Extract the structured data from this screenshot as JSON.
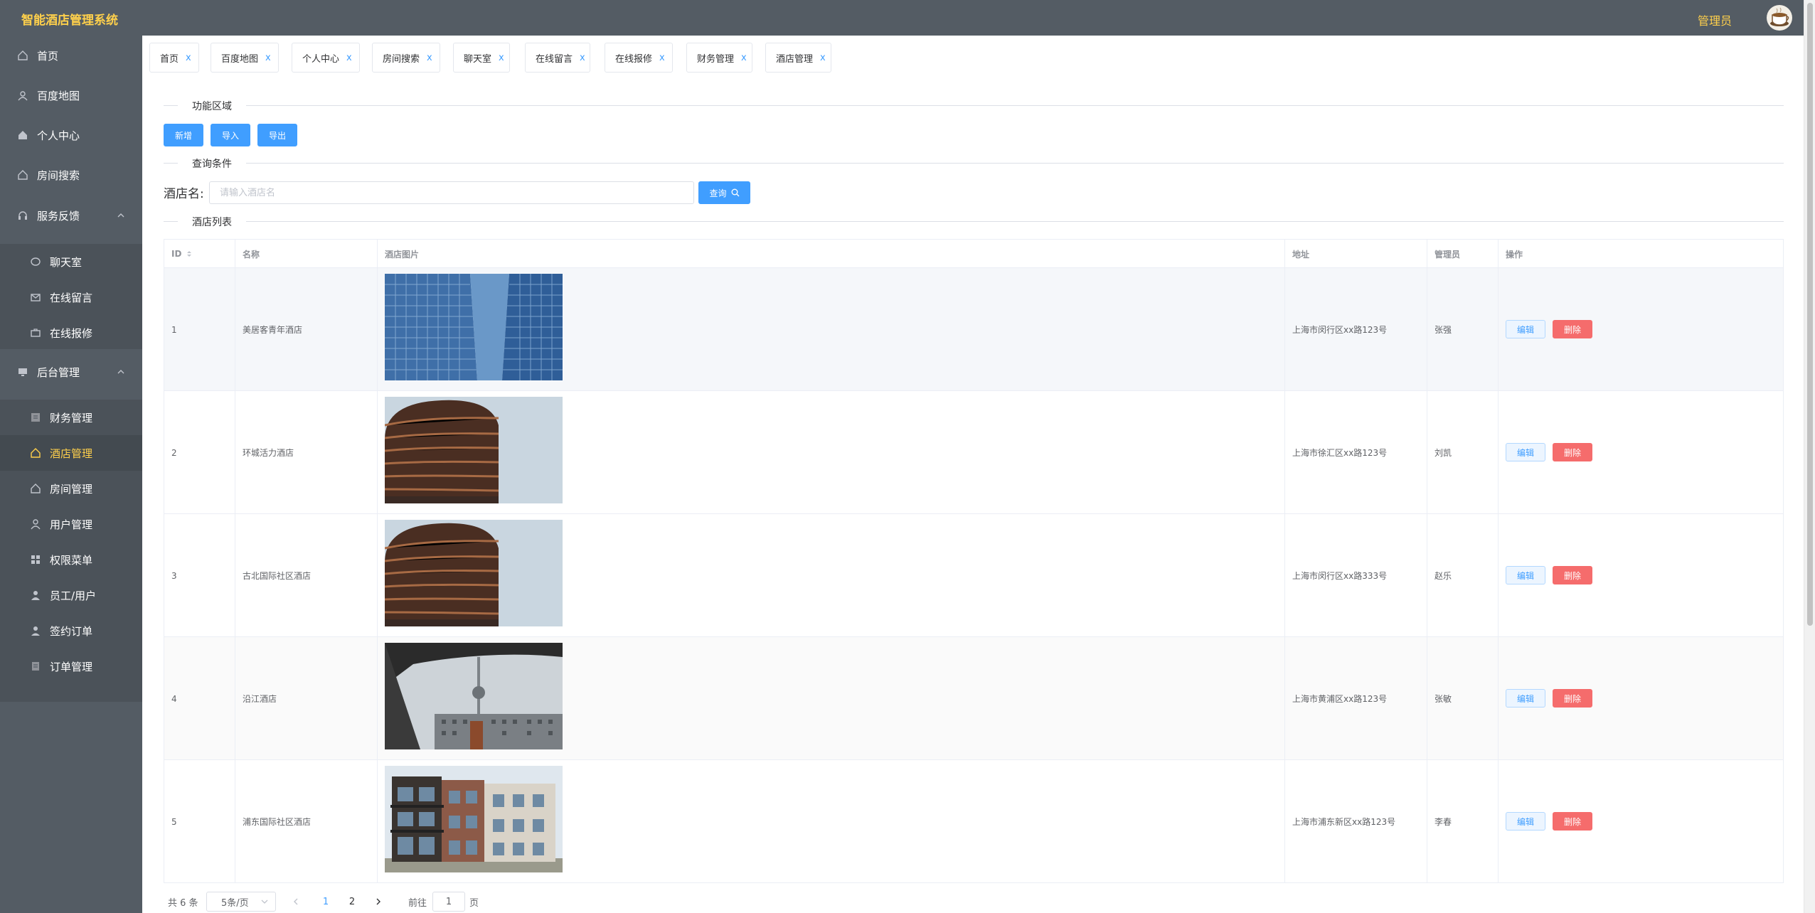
{
  "header": {
    "app_title": "智能酒店管理系统",
    "user_role": "管理员"
  },
  "sidebar": {
    "items": [
      {
        "label": "首页",
        "icon": "home-icon"
      },
      {
        "label": "百度地图",
        "icon": "map-icon"
      },
      {
        "label": "个人中心",
        "icon": "user-home-icon"
      },
      {
        "label": "房间搜索",
        "icon": "house-icon"
      },
      {
        "label": "服务反馈",
        "icon": "headset-icon"
      },
      {
        "label": "聊天室",
        "icon": "chat-icon"
      },
      {
        "label": "在线留言",
        "icon": "message-icon"
      },
      {
        "label": "在线报修",
        "icon": "briefcase-icon"
      },
      {
        "label": "后台管理",
        "icon": "monitor-icon"
      },
      {
        "label": "财务管理",
        "icon": "finance-icon"
      },
      {
        "label": "酒店管理",
        "icon": "hotel-icon"
      },
      {
        "label": "房间管理",
        "icon": "room-icon"
      },
      {
        "label": "用户管理",
        "icon": "user-icon"
      },
      {
        "label": "权限菜单",
        "icon": "grid-icon"
      },
      {
        "label": "员工/用户",
        "icon": "staff-icon"
      },
      {
        "label": "签约订单",
        "icon": "contract-icon"
      },
      {
        "label": "订单管理",
        "icon": "order-icon"
      }
    ],
    "active": "酒店管理"
  },
  "tabs": [
    {
      "label": "首页",
      "close": "x"
    },
    {
      "label": "百度地图",
      "close": "x"
    },
    {
      "label": "个人中心",
      "close": "x"
    },
    {
      "label": "房间搜索",
      "close": "x"
    },
    {
      "label": "聊天室",
      "close": "x"
    },
    {
      "label": "在线留言",
      "close": "x"
    },
    {
      "label": "在线报修",
      "close": "x"
    },
    {
      "label": "财务管理",
      "close": "x"
    },
    {
      "label": "酒店管理",
      "close": "x"
    }
  ],
  "sections": {
    "function_area": "功能区域",
    "query_conditions": "查询条件",
    "hotel_list": "酒店列表"
  },
  "actions": {
    "add": "新增",
    "import": "导入",
    "export": "导出"
  },
  "search": {
    "label": "酒店名:",
    "placeholder": "请输入酒店名",
    "button": "查询"
  },
  "table": {
    "headers": {
      "id": "ID",
      "name": "名称",
      "image": "酒店图片",
      "address": "地址",
      "manager": "管理员",
      "actions": "操作"
    },
    "edit_label": "编辑",
    "delete_label": "删除",
    "rows": [
      {
        "id": "1",
        "name": "美居客青年酒店",
        "address": "上海市闵行区xx路123号",
        "manager": "张强"
      },
      {
        "id": "2",
        "name": "环城活力酒店",
        "address": "上海市徐汇区xx路123号",
        "manager": "刘凯"
      },
      {
        "id": "3",
        "name": "古北国际社区酒店",
        "address": "上海市闵行区xx路333号",
        "manager": "赵乐"
      },
      {
        "id": "4",
        "name": "沿江酒店",
        "address": "上海市黄浦区xx路123号",
        "manager": "张敏"
      },
      {
        "id": "5",
        "name": "浦东国际社区酒店",
        "address": "上海市浦东新区xx路123号",
        "manager": "李春"
      }
    ]
  },
  "pagination": {
    "total": "共 6 条",
    "page_size": "5条/页",
    "pages": [
      "1",
      "2"
    ],
    "current": "1",
    "goto_label": "前往",
    "goto_value": "1",
    "page_suffix": "页"
  },
  "colors": {
    "sidebar_bg": "#545c64",
    "accent_yellow": "#ffd04b",
    "primary_blue": "#409eff",
    "danger_red": "#f56c6c"
  }
}
